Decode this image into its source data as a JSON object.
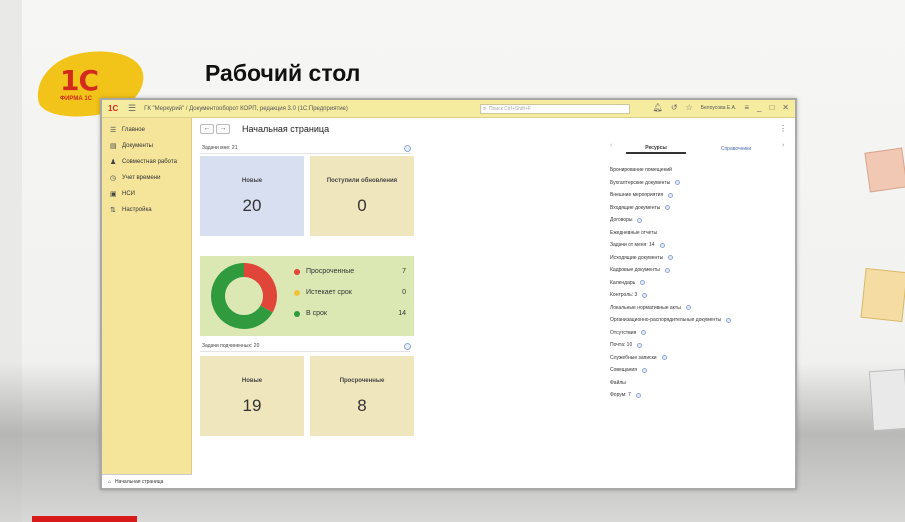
{
  "slide": {
    "title": "Рабочий стол",
    "logo_text": "1С",
    "logo_subtext": "ФИРМА 1С"
  },
  "window": {
    "logo": "1С",
    "title": "ГК \"Меркурий\" / Документооборот КОРП, редакция 3.0  (1С:Предприятие)",
    "search_placeholder": "Поиск Ctrl+Shift+F",
    "user": "Белоусова Е.А."
  },
  "sidebar": {
    "items": [
      {
        "icon": "list-icon",
        "label": "Главное"
      },
      {
        "icon": "documents-icon",
        "label": "Документы"
      },
      {
        "icon": "people-icon",
        "label": "Совместная работа"
      },
      {
        "icon": "clock-icon",
        "label": "Учет времени"
      },
      {
        "icon": "book-icon",
        "label": "НСИ"
      },
      {
        "icon": "settings-icon",
        "label": "Настройка"
      }
    ],
    "bottom_tab": "Начальная страница"
  },
  "page": {
    "title": "Начальная страница"
  },
  "tasks_me": {
    "label": "Задачи мне: 21",
    "tiles": [
      {
        "label": "Новые",
        "value": "20",
        "color": "#d7dff0"
      },
      {
        "label": "Поступили обновления",
        "value": "0",
        "color": "#efe6bd"
      }
    ],
    "legend": [
      {
        "label": "Просроченные",
        "value": "7",
        "color": "#e0453a"
      },
      {
        "label": "Истекает срок",
        "value": "0",
        "color": "#f0c23a"
      },
      {
        "label": "В срок",
        "value": "14",
        "color": "#2f9a3e"
      }
    ]
  },
  "tasks_sub": {
    "label": "Задачи подчиненных: 20",
    "tiles": [
      {
        "label": "Новые",
        "value": "19",
        "color": "#efe6bd"
      },
      {
        "label": "Просроченные",
        "value": "8",
        "color": "#efe6bd"
      }
    ]
  },
  "right_panel": {
    "tab_active": "Ресурсы",
    "tab_other": "Справочники",
    "links": [
      {
        "label": "Бронирование помещений",
        "icon": false
      },
      {
        "label": "Бухгалтерские документы",
        "icon": true
      },
      {
        "label": "Внешние мероприятия",
        "icon": true
      },
      {
        "label": "Входящие документы",
        "icon": true
      },
      {
        "label": "Договоры",
        "icon": true
      },
      {
        "label": "Ежедневные отчеты",
        "icon": false
      },
      {
        "label": "Задачи от меня: 14",
        "icon": true
      },
      {
        "label": "Исходящие документы",
        "icon": true
      },
      {
        "label": "Кадровые документы",
        "icon": true
      },
      {
        "label": "Календарь",
        "icon": true
      },
      {
        "label": "Контроль: 3",
        "icon": true
      },
      {
        "label": "Локальные нормативные акты",
        "icon": true
      },
      {
        "label": "Организационно-распорядительные документы",
        "icon": true
      },
      {
        "label": "Отсутствия",
        "icon": true
      },
      {
        "label": "Почта: 10",
        "icon": true
      },
      {
        "label": "Служебные записки",
        "icon": true
      },
      {
        "label": "Совещания",
        "icon": true
      },
      {
        "label": "Файлы",
        "icon": false
      },
      {
        "label": "Форум: 7",
        "icon": true
      }
    ]
  }
}
